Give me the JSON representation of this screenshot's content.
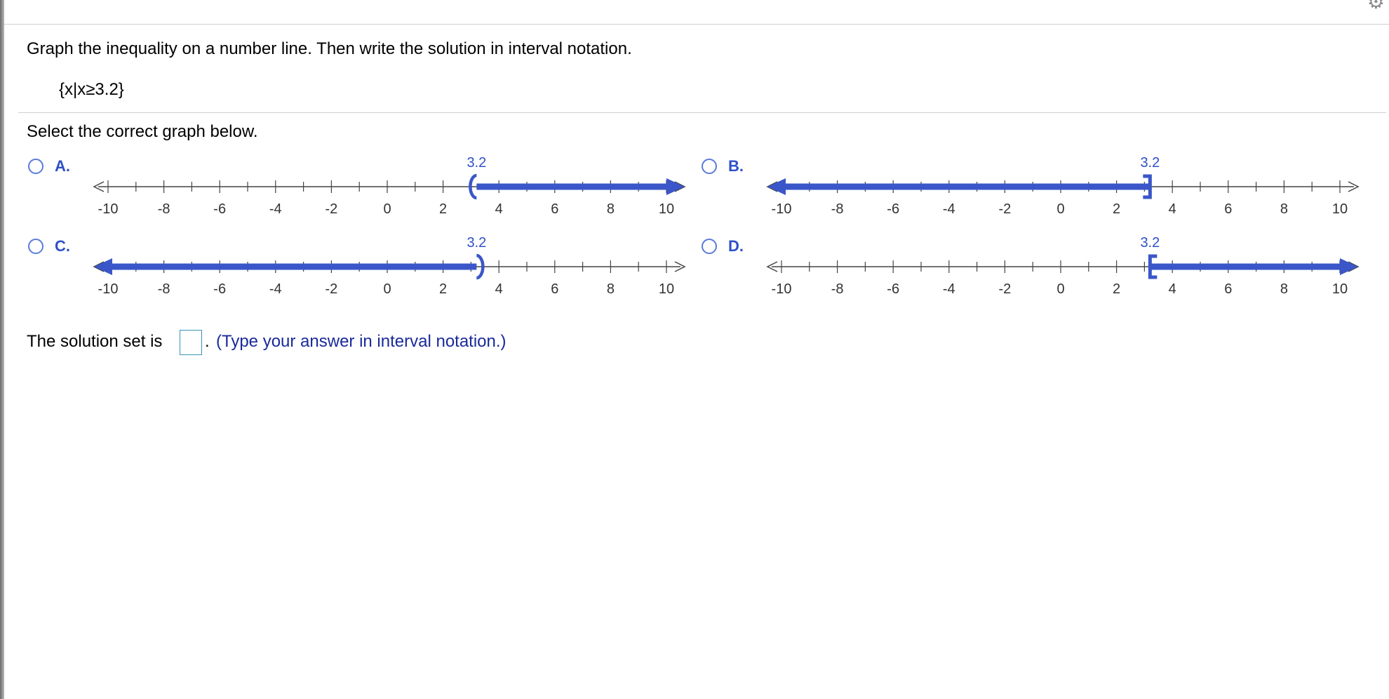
{
  "question": {
    "instruction": "Graph the inequality on a number line.  Then write the solution in interval notation.",
    "inequality": "{x|x≥3.2}"
  },
  "select_prompt": "Select the correct graph below.",
  "colors": {
    "shade": "#3a56c8",
    "axis": "#444444",
    "label_blue": "#2e50c8",
    "radio": "#5a7bd8"
  },
  "options": [
    {
      "letter": "A.",
      "boundary_label": "3.2",
      "chart_data": {
        "type": "number-line",
        "boundary": 3.2,
        "endpoint": "open-paren",
        "direction": "right",
        "ticks": [
          -10,
          -8,
          -6,
          -4,
          -2,
          0,
          2,
          4,
          6,
          8,
          10
        ],
        "tick_labels": [
          "-10",
          "-8",
          "-6",
          "-4",
          "-2",
          "0",
          "2",
          "4",
          "6",
          "8",
          "10"
        ],
        "xlim": [
          -10,
          10
        ]
      }
    },
    {
      "letter": "B.",
      "boundary_label": "3.2",
      "chart_data": {
        "type": "number-line",
        "boundary": 3.2,
        "endpoint": "closed-bracket",
        "direction": "left",
        "ticks": [
          -10,
          -8,
          -6,
          -4,
          -2,
          0,
          2,
          4,
          6,
          8,
          10
        ],
        "tick_labels": [
          "-10",
          "-8",
          "-6",
          "-4",
          "-2",
          "0",
          "2",
          "4",
          "6",
          "8",
          "10"
        ],
        "xlim": [
          -10,
          10
        ]
      }
    },
    {
      "letter": "C.",
      "boundary_label": "3.2",
      "chart_data": {
        "type": "number-line",
        "boundary": 3.2,
        "endpoint": "open-paren",
        "direction": "left",
        "ticks": [
          -10,
          -8,
          -6,
          -4,
          -2,
          0,
          2,
          4,
          6,
          8,
          10
        ],
        "tick_labels": [
          "-10",
          "-8",
          "-6",
          "-4",
          "-2",
          "0",
          "2",
          "4",
          "6",
          "8",
          "10"
        ],
        "xlim": [
          -10,
          10
        ]
      }
    },
    {
      "letter": "D.",
      "boundary_label": "3.2",
      "chart_data": {
        "type": "number-line",
        "boundary": 3.2,
        "endpoint": "closed-bracket",
        "direction": "right",
        "ticks": [
          -10,
          -8,
          -6,
          -4,
          -2,
          0,
          2,
          4,
          6,
          8,
          10
        ],
        "tick_labels": [
          "-10",
          "-8",
          "-6",
          "-4",
          "-2",
          "0",
          "2",
          "4",
          "6",
          "8",
          "10"
        ],
        "xlim": [
          -10,
          10
        ]
      }
    }
  ],
  "answer": {
    "prefix": "The solution set is",
    "value": "",
    "period": ".",
    "hint": "(Type your answer in interval notation.)"
  }
}
